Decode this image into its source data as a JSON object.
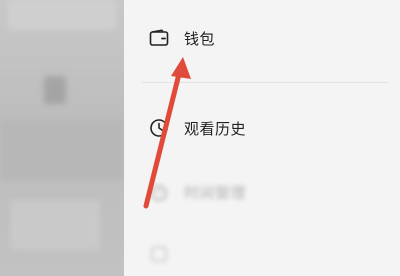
{
  "drawer": {
    "items": [
      {
        "label": "钱包",
        "icon": "wallet-icon",
        "state": "normal"
      },
      {
        "label": "观看历史",
        "icon": "clock-icon",
        "state": "normal"
      },
      {
        "label": "时间管理",
        "icon": "timer-icon",
        "state": "blurred"
      },
      {
        "label": "",
        "icon": "settings-icon",
        "state": "blurred"
      }
    ]
  },
  "annotation": {
    "arrow_color": "#e04a3a",
    "points_to": "钱包"
  },
  "colors": {
    "drawer_bg": "#f4f4f4",
    "overlay": "#bdbdbd",
    "text": "#222222"
  }
}
